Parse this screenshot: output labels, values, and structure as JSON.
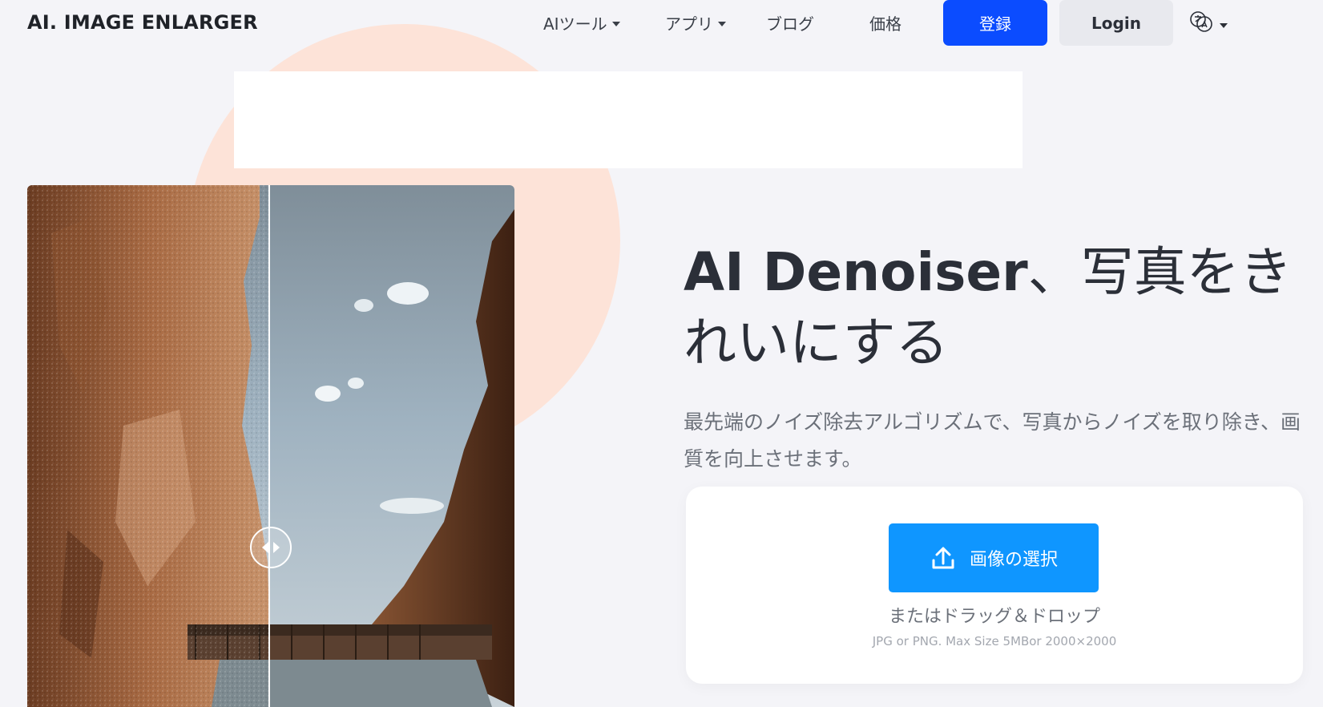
{
  "header": {
    "logo": "AI. IMAGE ENLARGER",
    "nav": [
      {
        "label": "AIツール",
        "dropdown": true
      },
      {
        "label": "アプリ",
        "dropdown": true
      },
      {
        "label": "ブログ",
        "dropdown": false
      },
      {
        "label": "価格",
        "dropdown": false
      }
    ],
    "register_label": "登録",
    "login_label": "Login",
    "language_icon": "translate-icon"
  },
  "comparison": {
    "divider_position": 0.52,
    "handle_icon": "left-right-arrows-icon"
  },
  "hero": {
    "title_strong": "AI Denoiser",
    "title_rest": "、写真をきれいにする",
    "description": "最先端のノイズ除去アルゴリズムで、写真からノイズを取り除き、画質を向上させます。"
  },
  "upload": {
    "select_label": "画像の選択",
    "select_icon": "upload-icon",
    "hint": "またはドラッグ＆ドロップ",
    "note": "JPG or PNG. Max Size 5MBor 2000×2000"
  },
  "colors": {
    "primary": "#0b4cff",
    "upload_button": "#0f96ff",
    "accent_circle": "#fde3d8",
    "background": "#f4f4f8"
  }
}
